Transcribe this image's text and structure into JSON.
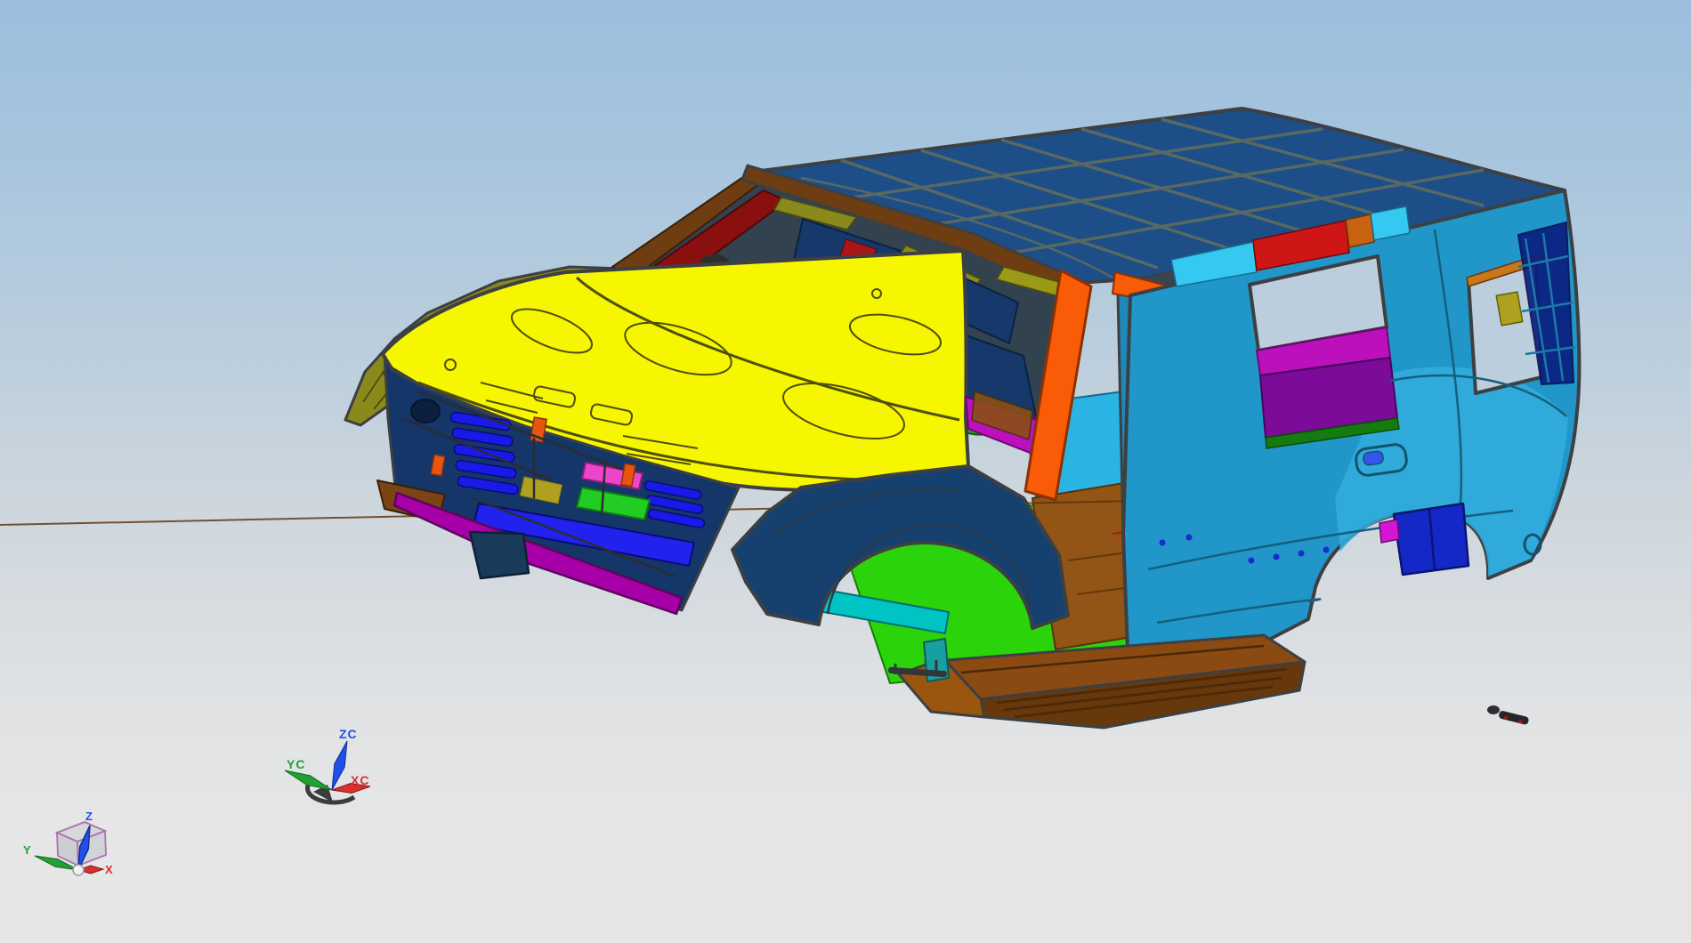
{
  "app": {
    "type": "cad-3d-viewport",
    "content": "SUV body-in-white assembly, trimetric view"
  },
  "viewport": {
    "wcs_triad": {
      "z_label": "ZC",
      "y_label": "YC",
      "x_label": "XC"
    },
    "abs_triad": {
      "z_label": "Z",
      "y_label": "Y",
      "x_label": "X"
    }
  },
  "colors": {
    "bg-top": "#9cbedd",
    "bg-bottom": "#e6e6e6",
    "outline": "#3d4043",
    "roof": "#1d4e87",
    "roof-line": "#5f6b5f",
    "hood": "#f6f600",
    "hood-line": "#4f4f0a",
    "olive": "#8a8a1c",
    "header-brown": "#6e3e12",
    "apillar-orange": "#f95b07",
    "fascia-navy": "#143668",
    "fender-navy": "#16406e",
    "grille-blue": "#1a1ae8",
    "bumper-magenta": "#a800a8",
    "green-bright": "#2bd40a",
    "green-dark": "#1c9012",
    "teal-body": "#2196c8",
    "teal-light": "#31aede",
    "teal-door": "#1e88ba",
    "cyan-rail": "#35c9f2",
    "red": "#cf1616",
    "maroon": "#8a1010",
    "purple": "#7c0b9a",
    "magenta": "#bb10bb",
    "gold": "#c49018",
    "floor-brown": "#925516",
    "floor-cyan": "#2ab4e4",
    "rocker-brown": "#8a4a12",
    "rocker-dark": "#66380b",
    "navy-inner": "#0a1f80",
    "sill-teal": "#00c4c4",
    "dash-navy": "#16386a",
    "interior-dark": "#33424f",
    "aperture-sky": "#bccddd",
    "axis-red": "#d83030",
    "axis-green": "#22a033",
    "axis-blue": "#2050e8",
    "cube-edge": "#b070b0"
  }
}
